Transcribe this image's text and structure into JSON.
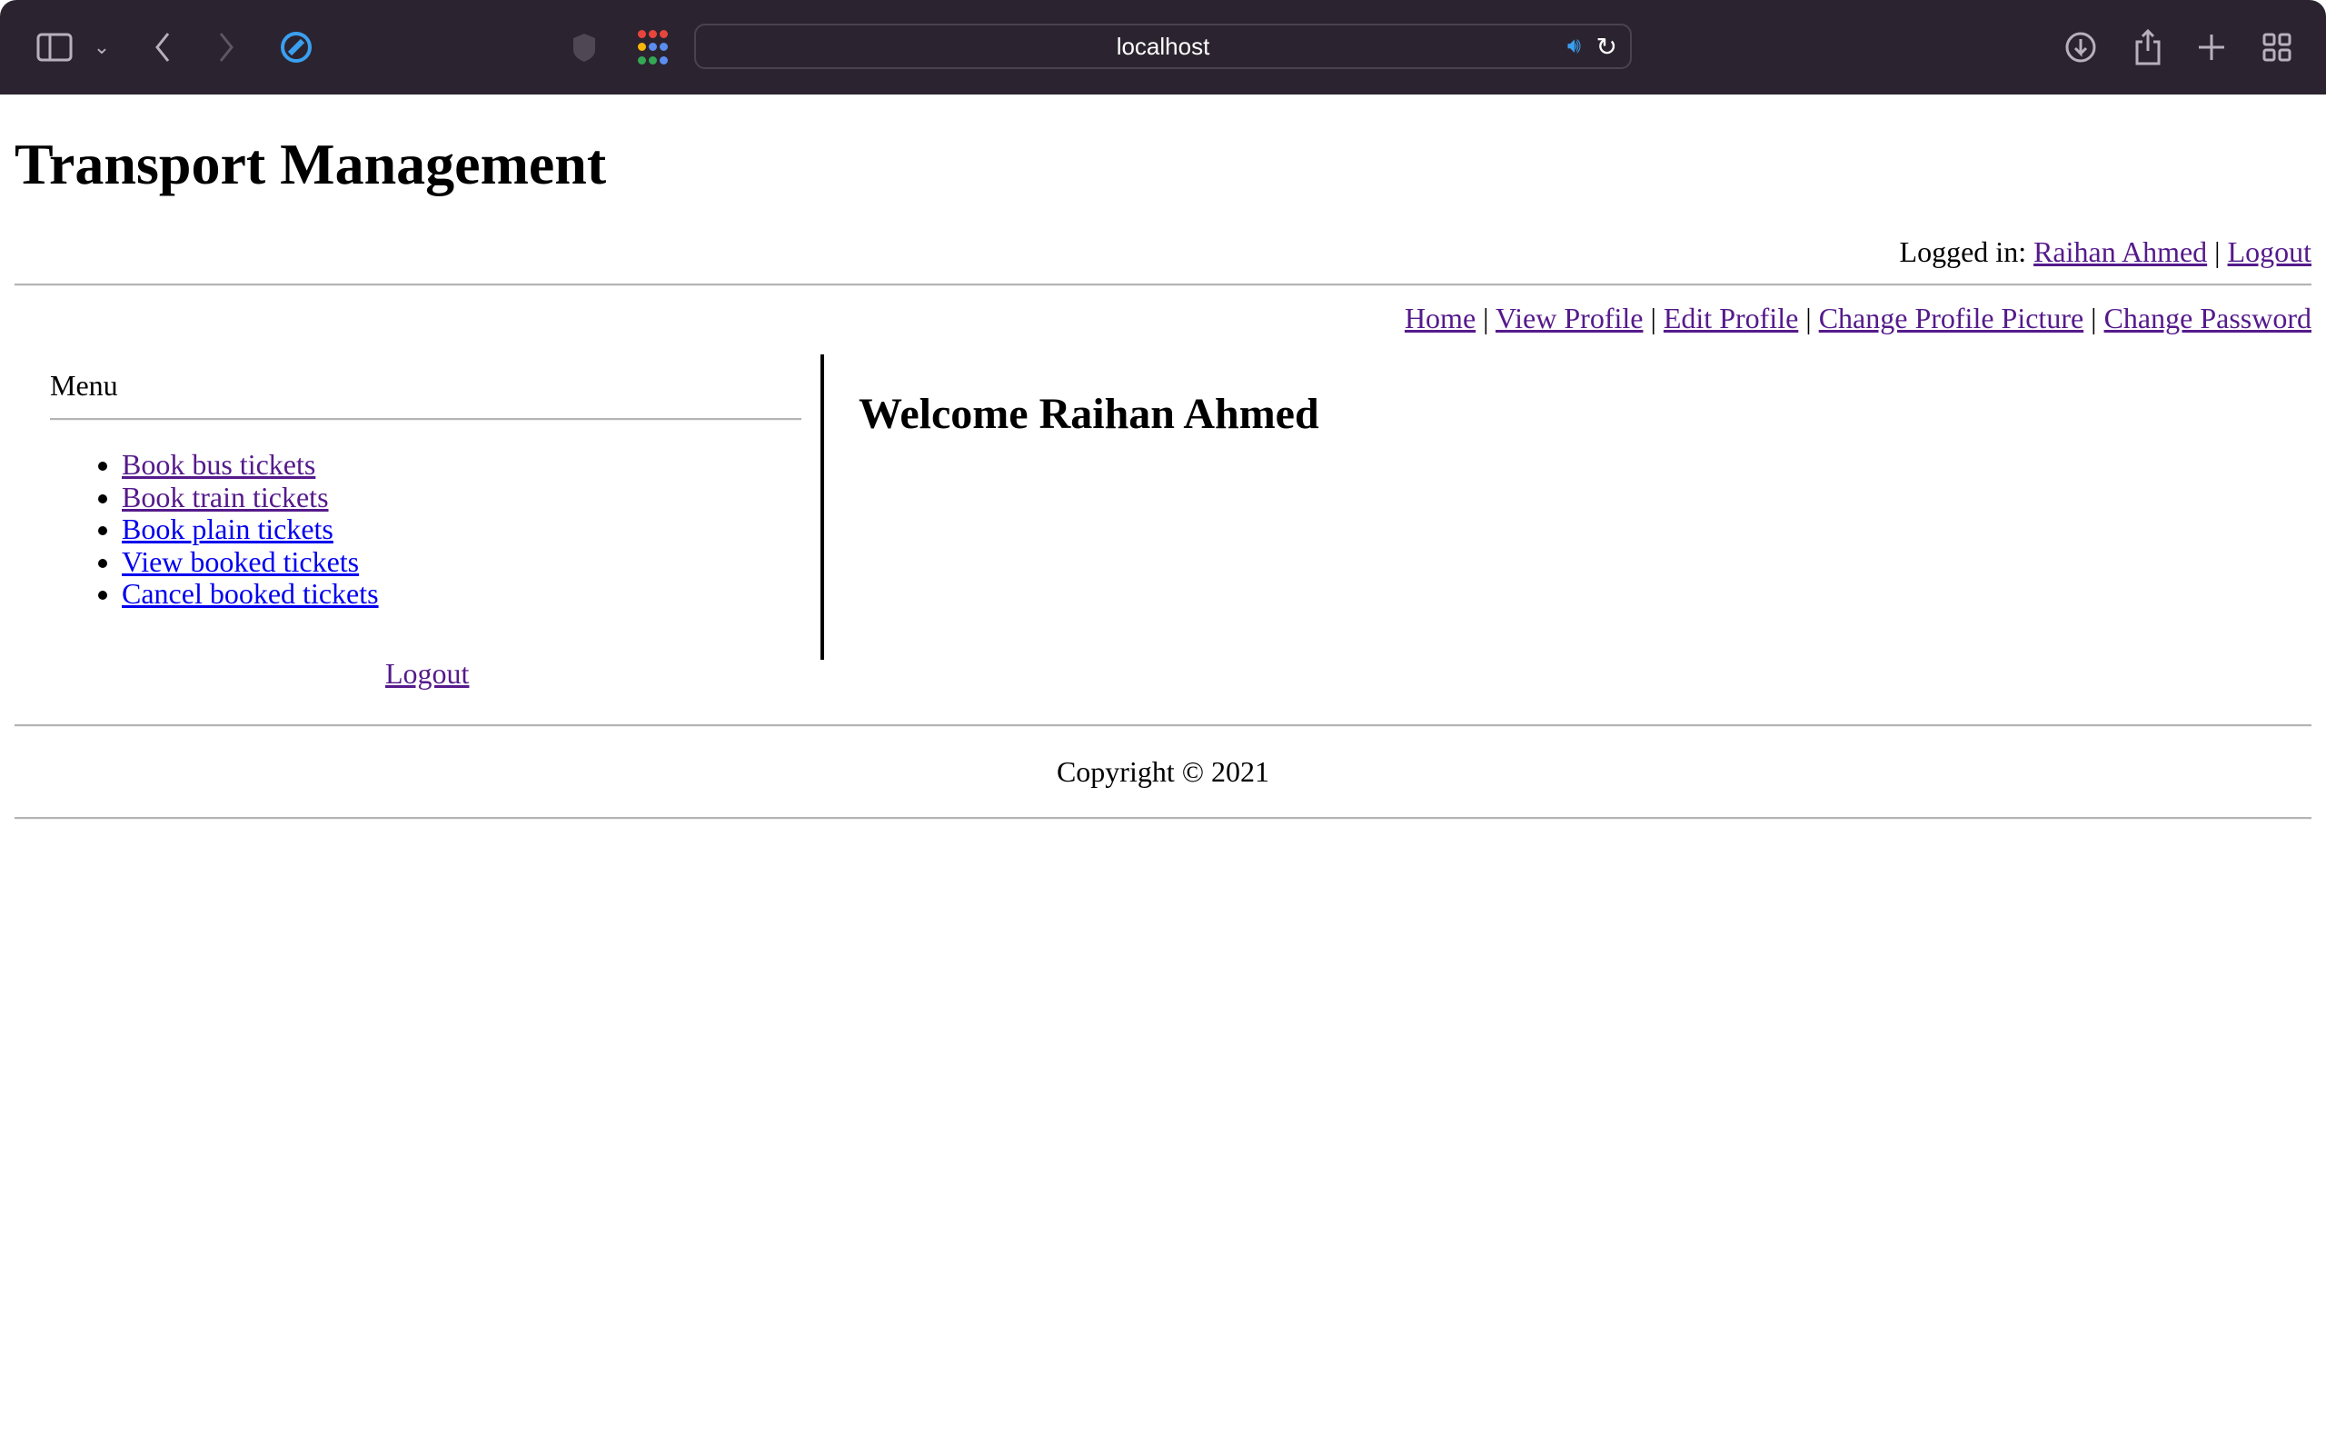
{
  "browser": {
    "url": "localhost",
    "colors": {
      "toolbar": "#2b2430",
      "accent": "#3aa0f0"
    }
  },
  "header": {
    "title": "Transport Management",
    "logged_in_label": "Logged in:",
    "user_name": "Raihan Ahmed",
    "separator": "|",
    "logout": "Logout"
  },
  "nav": {
    "items": [
      {
        "label": "Home"
      },
      {
        "label": "View Profile"
      },
      {
        "label": "Edit Profile"
      },
      {
        "label": "Change Profile Picture"
      },
      {
        "label": "Change Password"
      }
    ],
    "separator": "|"
  },
  "sidebar": {
    "title": "Menu",
    "items": [
      {
        "label": "Book bus tickets",
        "visited": true
      },
      {
        "label": "Book train tickets",
        "visited": true
      },
      {
        "label": "Book plain tickets",
        "visited": false
      },
      {
        "label": "View booked tickets",
        "visited": false
      },
      {
        "label": "Cancel booked tickets",
        "visited": false
      }
    ],
    "logout": "Logout"
  },
  "main": {
    "welcome": "Welcome Raihan Ahmed"
  },
  "footer": {
    "copyright": "Copyright © 2021"
  }
}
